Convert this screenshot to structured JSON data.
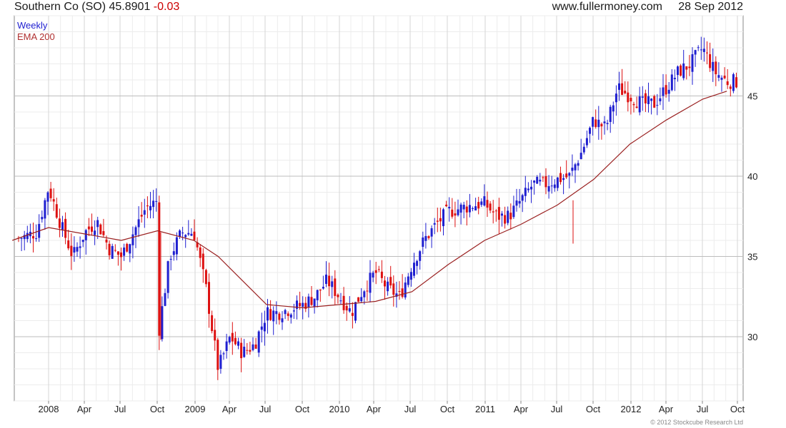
{
  "header": {
    "title": "Southern Co (SO) 45.8901",
    "change": "-0.03",
    "site": "www.fullermoney.com",
    "date": "28 Sep 2012"
  },
  "legend": {
    "frequency": "Weekly",
    "overlay": "EMA 200"
  },
  "copyright": "© 2012 Stockcube Research Ltd",
  "colors": {
    "up": "#1f1fd0",
    "down": "#dd1111",
    "ema": "#9a2020",
    "grid": "#d6d6d6"
  },
  "chart_data": {
    "type": "candlestick",
    "ylim": [
      26,
      50
    ],
    "y_ticks": [
      30,
      35,
      40,
      45
    ],
    "x_tick_labels": [
      "2008",
      "Apr",
      "Jul",
      "Oct",
      "2009",
      "Apr",
      "Jul",
      "Oct",
      "2010",
      "Apr",
      "Jul",
      "Oct",
      "2011",
      "Apr",
      "Jul",
      "Oct",
      "2012",
      "Apr",
      "Jul",
      "Oct"
    ],
    "grid": true,
    "series": [
      {
        "name": "Weekly",
        "approx_close_path": [
          [
            "Oct 2007",
            36.0
          ],
          [
            "Dec 2007",
            36.5
          ],
          [
            "Jan 2008",
            39.3
          ],
          [
            "Feb 2008",
            37.0
          ],
          [
            "Mar 2008",
            35.0
          ],
          [
            "Apr 2008",
            36.5
          ],
          [
            "May 2008",
            37.2
          ],
          [
            "Jun 2008",
            35.5
          ],
          [
            "Jul 2008",
            35.0
          ],
          [
            "Aug 2008",
            36.5
          ],
          [
            "Sep 2008",
            38.0
          ],
          [
            "Oct 2008",
            38.5
          ],
          [
            "Oct 2008 low",
            29.8
          ],
          [
            "Nov 2008",
            35.0
          ],
          [
            "Dec 2008",
            36.5
          ],
          [
            "Jan 2009",
            36.5
          ],
          [
            "Feb 2009",
            33.0
          ],
          [
            "Mar 2009",
            28.0
          ],
          [
            "Apr 2009",
            30.0
          ],
          [
            "May 2009",
            29.0
          ],
          [
            "Jun 2009",
            29.5
          ],
          [
            "Jul 2009",
            31.5
          ],
          [
            "Aug 2009",
            31.5
          ],
          [
            "Oct 2009",
            32.0
          ],
          [
            "Nov 2009",
            32.5
          ],
          [
            "Dec 2009",
            33.5
          ],
          [
            "Jan 2010",
            32.5
          ],
          [
            "Feb 2010",
            31.5
          ],
          [
            "Mar 2010",
            33.0
          ],
          [
            "Apr 2010",
            34.0
          ],
          [
            "May 2010",
            33.0
          ],
          [
            "Jun 2010",
            32.5
          ],
          [
            "Jul 2010",
            34.5
          ],
          [
            "Aug 2010",
            36.0
          ],
          [
            "Sep 2010",
            37.0
          ],
          [
            "Oct 2010",
            37.8
          ],
          [
            "Nov 2010",
            38.0
          ],
          [
            "Dec 2010",
            38.2
          ],
          [
            "Jan 2011",
            38.3
          ],
          [
            "Feb 2011",
            37.5
          ],
          [
            "Mar 2011",
            37.5
          ],
          [
            "Apr 2011",
            38.5
          ],
          [
            "May 2011",
            39.5
          ],
          [
            "Jun 2011",
            39.5
          ],
          [
            "Jul 2011",
            39.8
          ],
          [
            "Aug 2011",
            40.0
          ],
          [
            "Sep 2011",
            41.5
          ],
          [
            "Oct 2011",
            43.5
          ],
          [
            "Nov 2011",
            43.0
          ],
          [
            "Dec 2011",
            45.5
          ],
          [
            "Jan 2012",
            45.0
          ],
          [
            "Feb 2012",
            44.5
          ],
          [
            "Mar 2012",
            44.5
          ],
          [
            "Apr 2012",
            45.5
          ],
          [
            "May 2012",
            46.5
          ],
          [
            "Jun 2012",
            47.0
          ],
          [
            "Jul 2012",
            48.0
          ],
          [
            "Aug 2012",
            46.5
          ],
          [
            "Sep 2012",
            45.9
          ]
        ]
      },
      {
        "name": "EMA 200",
        "approx_path": [
          [
            "Oct 2007",
            36.0
          ],
          [
            "Jan 2008",
            36.8
          ],
          [
            "Apr 2008",
            36.4
          ],
          [
            "Jul 2008",
            36.0
          ],
          [
            "Oct 2008",
            36.6
          ],
          [
            "Jan 2009",
            36.0
          ],
          [
            "Mar 2009",
            35.0
          ],
          [
            "May 2009",
            33.5
          ],
          [
            "Jul 2009",
            32.0
          ],
          [
            "Oct 2009",
            31.8
          ],
          [
            "Jan 2010",
            32.0
          ],
          [
            "Apr 2010",
            32.2
          ],
          [
            "Jul 2010",
            32.8
          ],
          [
            "Oct 2010",
            34.5
          ],
          [
            "Jan 2011",
            36.0
          ],
          [
            "Apr 2011",
            37.0
          ],
          [
            "Jul 2011",
            38.2
          ],
          [
            "Oct 2011",
            39.8
          ],
          [
            "Jan 2012",
            42.0
          ],
          [
            "Apr 2012",
            43.5
          ],
          [
            "Jul 2012",
            44.8
          ],
          [
            "Sep 2012",
            45.3
          ]
        ]
      }
    ]
  }
}
